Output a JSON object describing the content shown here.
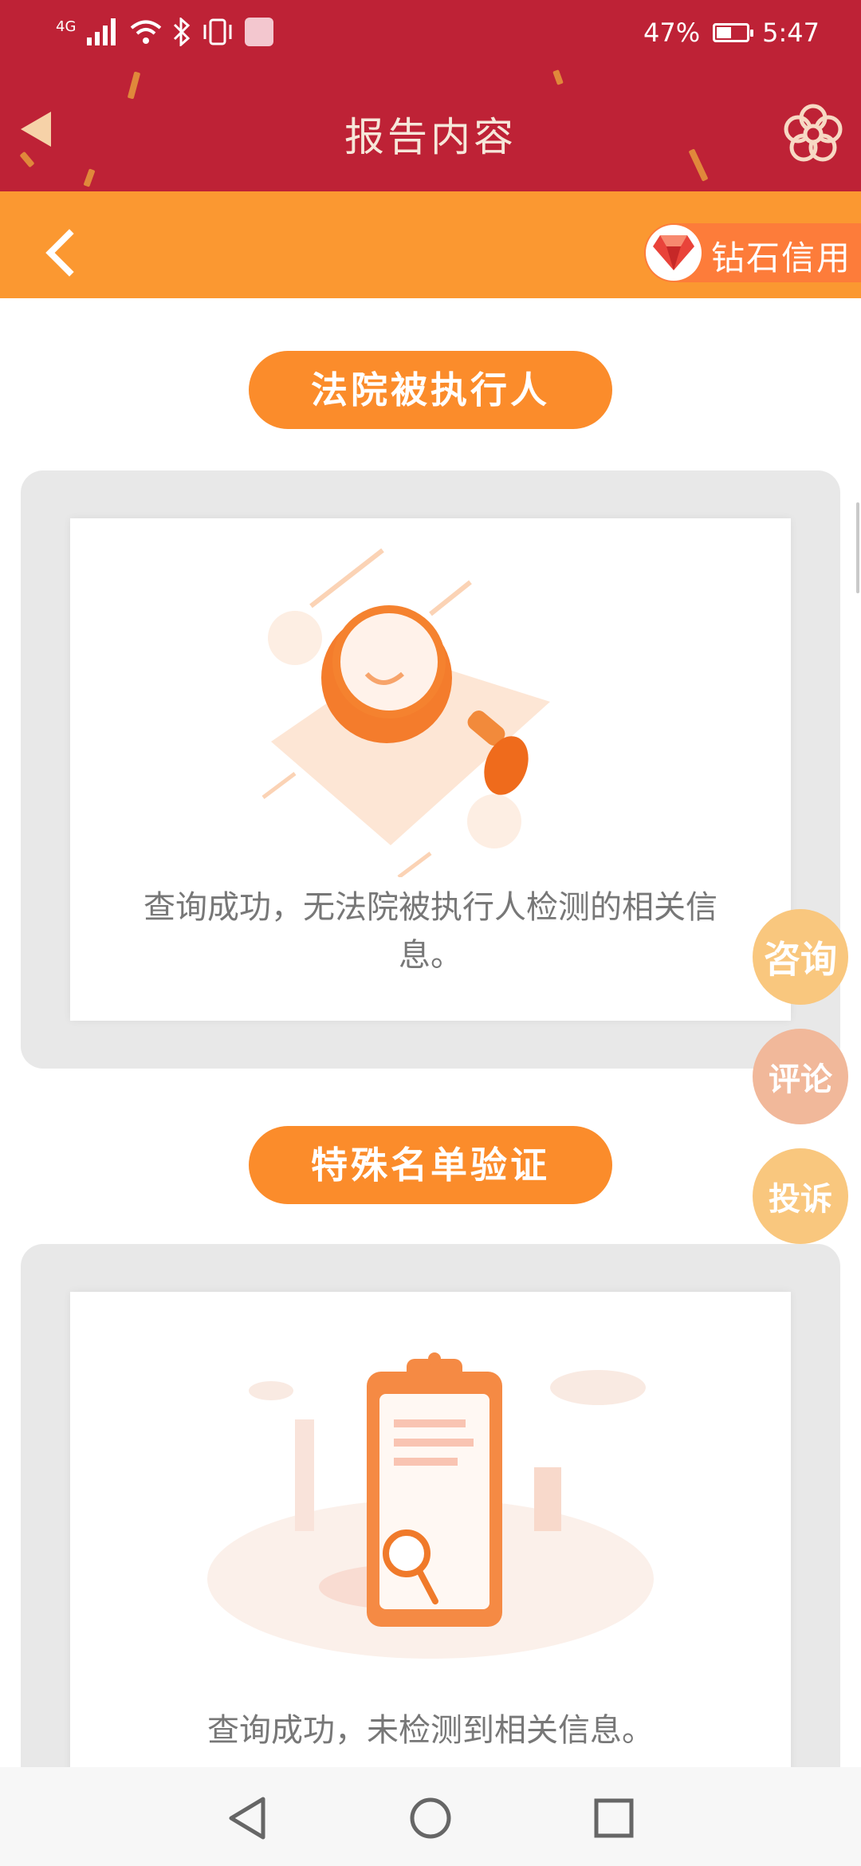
{
  "status_bar": {
    "network": "4G",
    "battery_percent": "47%",
    "battery_level": 0.47,
    "time": "5:47"
  },
  "header": {
    "title": "报告内容",
    "brand_label": "钻石信用"
  },
  "sections": [
    {
      "title": "法院被执行人",
      "result": "查询成功，无法院被执行人检测的相关信息。"
    },
    {
      "title": "特殊名单验证",
      "result": "查询成功，未检测到相关信息。"
    }
  ],
  "floating_actions": [
    {
      "label": "咨询",
      "color": "#f9c77e"
    },
    {
      "label": "评论",
      "color": "#f1b89a"
    },
    {
      "label": "投诉",
      "color": "#f9c77e"
    }
  ],
  "colors": {
    "header_red": "#be2236",
    "bar_orange": "#fb9831",
    "pill_orange": "#fb8c2b"
  }
}
